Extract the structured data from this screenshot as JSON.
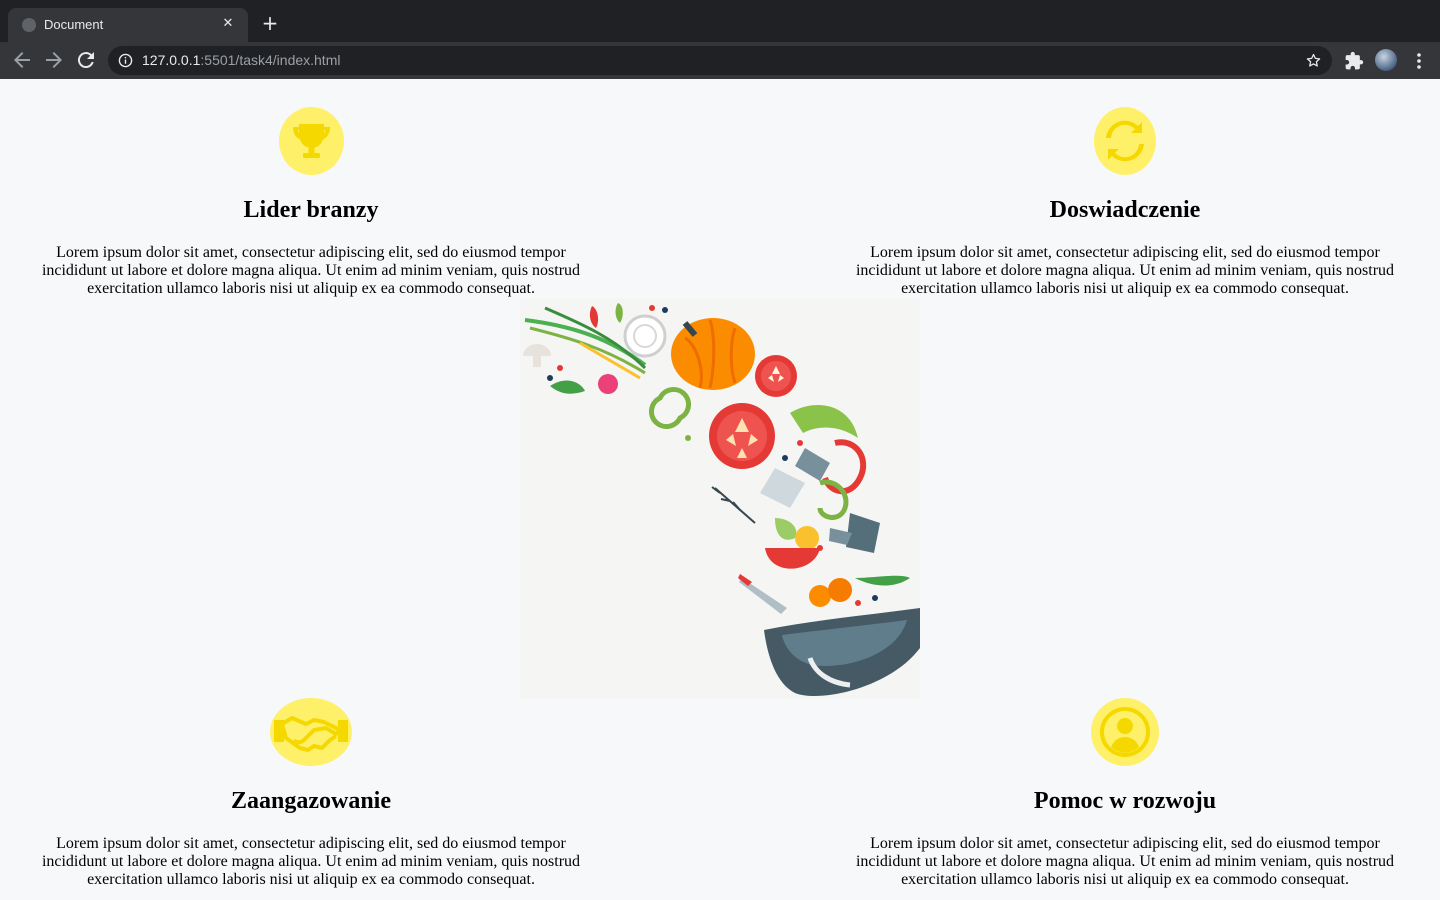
{
  "browser": {
    "tab_title": "Document",
    "tab_close": "✕",
    "new_tab": "+",
    "url_host": "127.0.0.1",
    "url_path": ":5501/task4/index.html"
  },
  "colors": {
    "icon_circle": "#fff06a",
    "icon_glyph": "#f5d800"
  },
  "features": [
    {
      "icon": "trophy-icon",
      "title": "Lider branzy",
      "text": "Lorem ipsum dolor sit amet, consectetur adipiscing elit, sed do eiusmod tempor incididunt ut labore et dolore magna aliqua. Ut enim ad minim veniam, quis nostrud exercitation ullamco laboris nisi ut aliquip ex ea commodo consequat."
    },
    {
      "icon": "sync-icon",
      "title": "Doswiadczenie",
      "text": "Lorem ipsum dolor sit amet, consectetur adipiscing elit, sed do eiusmod tempor incididunt ut labore et dolore magna aliqua. Ut enim ad minim veniam, quis nostrud exercitation ullamco laboris nisi ut aliquip ex ea commodo consequat."
    },
    {
      "icon": "handshake-icon",
      "title": "Zaangazowanie",
      "text": "Lorem ipsum dolor sit amet, consectetur adipiscing elit, sed do eiusmod tempor incididunt ut labore et dolore magna aliqua. Ut enim ad minim veniam, quis nostrud exercitation ullamco laboris nisi ut aliquip ex ea commodo consequat."
    },
    {
      "icon": "user-circle-icon",
      "title": "Pomoc w rozwoju",
      "text": "Lorem ipsum dolor sit amet, consectetur adipiscing elit, sed do eiusmod tempor incididunt ut labore et dolore magna aliqua. Ut enim ad minim veniam, quis nostrud exercitation ullamco laboris nisi ut aliquip ex ea commodo consequat."
    }
  ],
  "hero": {
    "image": "cooking-vegetables-bowl-illustration"
  }
}
